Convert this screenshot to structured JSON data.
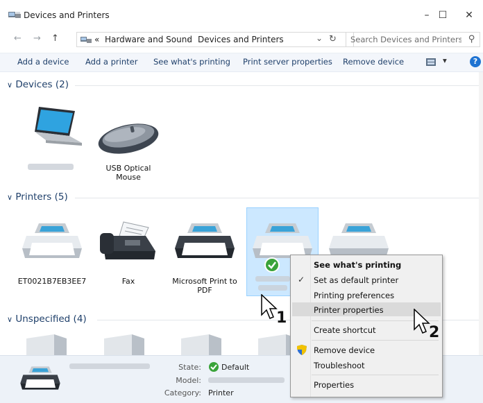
{
  "window": {
    "title": "Devices and Printers",
    "minimize": "–",
    "maximize": "☐",
    "close": "✕"
  },
  "address": {
    "back": "←",
    "forward": "→",
    "up": "↑",
    "overflow": "«",
    "crumbs": [
      "Hardware and Sound",
      "Devices and Printers"
    ],
    "separator": "›",
    "dropdown": "⌄",
    "refresh": "↻",
    "search_placeholder": "Search Devices and Printers",
    "search_icon": "⚲"
  },
  "toolbar": {
    "items": [
      "Add a device",
      "Add a printer",
      "See what's printing",
      "Print server properties",
      "Remove device"
    ],
    "view_arrow": "▾",
    "help": "?"
  },
  "groups": {
    "devices": {
      "label": "Devices (2)",
      "chevron": "∨"
    },
    "printers": {
      "label": "Printers (5)",
      "chevron": "∨"
    },
    "unspecified": {
      "label": "Unspecified (4)",
      "chevron": "∨"
    }
  },
  "devices": [
    {
      "label": "",
      "icon": "laptop-icon"
    },
    {
      "label": "USB Optical Mouse",
      "icon": "mouse-icon"
    }
  ],
  "printers": [
    {
      "label": "ET0021B7EB3EE7",
      "icon": "printer-icon"
    },
    {
      "label": "Fax",
      "icon": "fax-icon"
    },
    {
      "label": "Microsoft Print to PDF",
      "icon": "printer-dark-icon"
    },
    {
      "label": "",
      "icon": "printer-icon",
      "selected": true,
      "default": true
    },
    {
      "label": "",
      "icon": "printer-icon"
    }
  ],
  "context_menu": {
    "items": [
      {
        "label": "See what's printing",
        "bold": true
      },
      {
        "label": "Set as default printer",
        "checked": true
      },
      {
        "label": "Printing preferences"
      },
      {
        "label": "Printer properties",
        "highlighted": true
      },
      {
        "label": "Create shortcut"
      },
      {
        "label": "Remove device",
        "icon": "shield-icon"
      },
      {
        "label": "Troubleshoot"
      },
      {
        "label": "Properties"
      }
    ],
    "check": "✓"
  },
  "callouts": {
    "step1": "1",
    "step2": "2"
  },
  "details": {
    "state_label": "State:",
    "state_value": "Default",
    "model_label": "Model:",
    "category_label": "Category:",
    "category_value": "Printer"
  },
  "colors": {
    "accent_text": "#1e3f6a",
    "selection": "#cce8ff",
    "default_badge": "#3aa33a",
    "help_blue": "#1e73d2"
  }
}
